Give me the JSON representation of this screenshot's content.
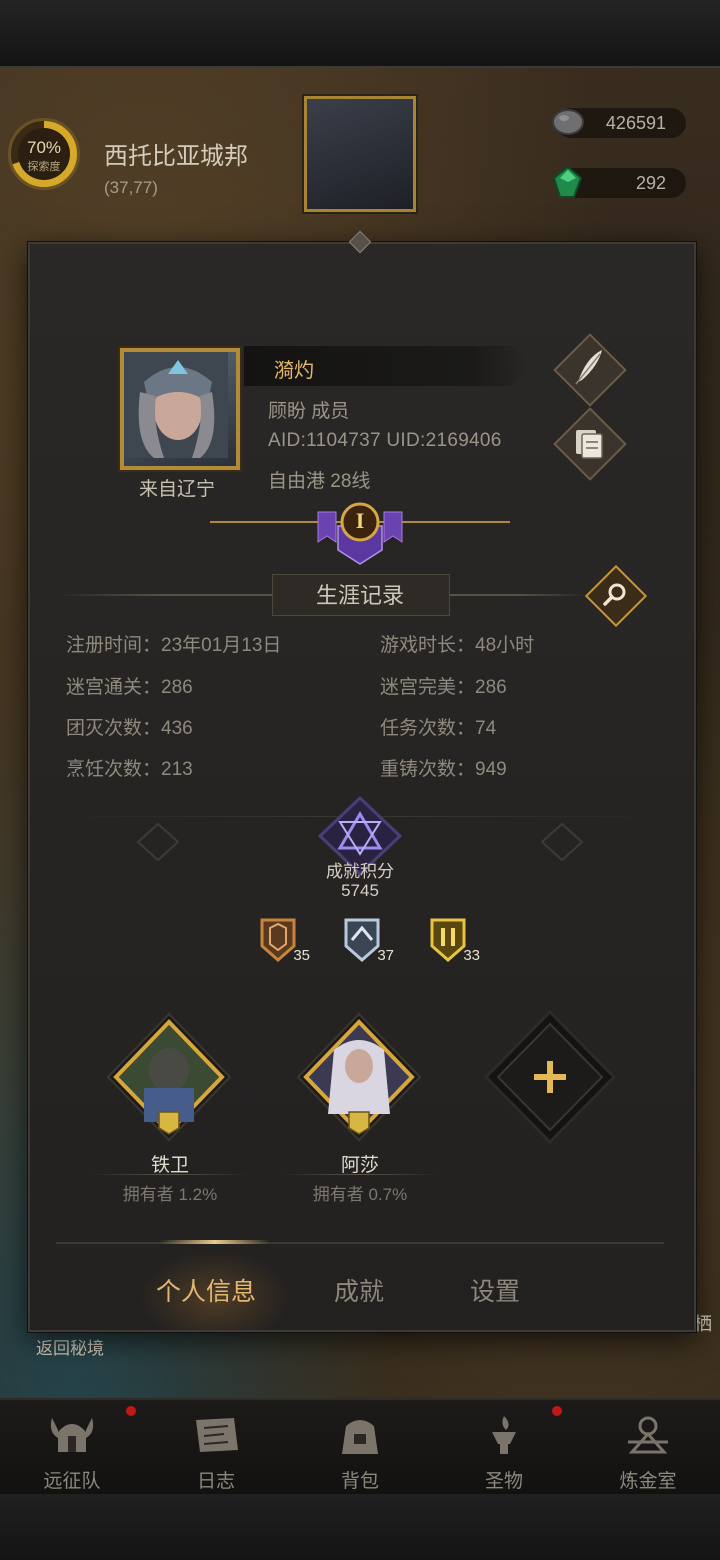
{
  "hud": {
    "explore_percent": "70%",
    "explore_label": "探索度",
    "city_name": "西托比亚城邦",
    "city_coords": "(37,77)",
    "resource_stone": "426591",
    "resource_gem": "292",
    "back_label": "返回秘境",
    "side_label": "栖"
  },
  "profile": {
    "player_name": "漪灼",
    "guild_role": "顾盼 成员",
    "ids": "AID:1104737   UID:2169406",
    "server": "自由港 28线",
    "from_label": "来自辽宁",
    "rank_numeral": "I"
  },
  "career": {
    "title": "生涯记录",
    "stats_left": [
      {
        "label": "注册时间：",
        "value": "23年01月13日"
      },
      {
        "label": "迷宫通关：",
        "value": "286"
      },
      {
        "label": "团灭次数：",
        "value": "436"
      },
      {
        "label": "烹饪次数：",
        "value": "213"
      }
    ],
    "stats_right": [
      {
        "label": "游戏时长：",
        "value": "48小时"
      },
      {
        "label": "迷宫完美：",
        "value": "286"
      },
      {
        "label": "任务次数：",
        "value": "74"
      },
      {
        "label": "重铸次数：",
        "value": "949"
      }
    ]
  },
  "achievement": {
    "label": "成就积分",
    "score": "5745",
    "badges": [
      {
        "tier": "bronze",
        "count": "35",
        "color": "#b8773a"
      },
      {
        "tier": "silver",
        "count": "37",
        "color": "#a9b8c8"
      },
      {
        "tier": "gold",
        "count": "33",
        "color": "#d8b642"
      }
    ]
  },
  "heroes": [
    {
      "name": "铁卫",
      "ownership": "拥有者 1.2%"
    },
    {
      "name": "阿莎",
      "ownership": "拥有者 0.7%"
    }
  ],
  "tabs": {
    "personal_info": "个人信息",
    "achievements": "成就",
    "settings": "设置"
  },
  "bottom_nav": [
    {
      "label": "远征队",
      "icon": "viking-helmet-icon",
      "badge": true
    },
    {
      "label": "日志",
      "icon": "scroll-map-icon",
      "badge": false
    },
    {
      "label": "背包",
      "icon": "bag-icon",
      "badge": false
    },
    {
      "label": "圣物",
      "icon": "brazier-icon",
      "badge": true
    },
    {
      "label": "炼金室",
      "icon": "alchemy-icon",
      "badge": false
    }
  ],
  "colors": {
    "accent_gold": "#c6953a",
    "name_gold": "#e2b968",
    "badge_red": "#c01818",
    "panel_bg": "#252321"
  }
}
